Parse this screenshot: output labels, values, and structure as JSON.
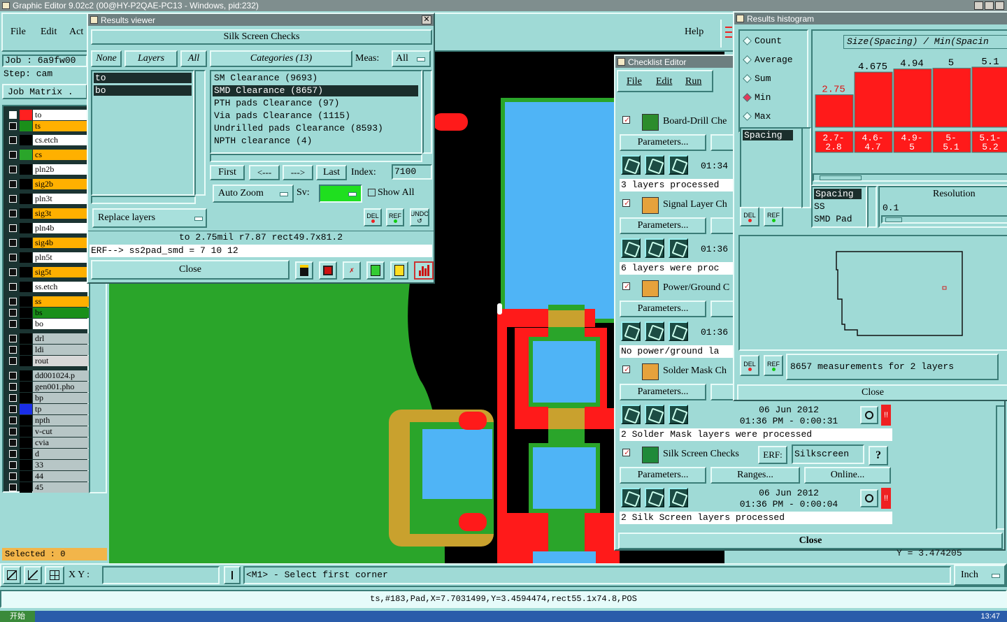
{
  "app": {
    "title": "Graphic Editor 9.02c2 (00@HY-P2QAE-PC13 - Windows, pid:232)"
  },
  "menu": {
    "file": "File",
    "edit": "Edit",
    "actions": "Act",
    "help": "Help"
  },
  "job": {
    "job_line": "Job :  6a9fw00",
    "step_line": "Step:  cam",
    "matrix_btn": "Job Matrix ."
  },
  "layers": [
    {
      "name": "to",
      "color": "#ff2020",
      "bg": "#ffffff"
    },
    {
      "name": "ts",
      "color": "#1a8f1a",
      "bg": "#ffb000"
    },
    {
      "name": "cs.etch",
      "color": "#000000",
      "bg": "#ffffff"
    },
    {
      "name": "cs",
      "color": "#2aa52a",
      "bg": "#ffb000"
    },
    {
      "name": "pln2b",
      "color": "#000000",
      "bg": "#ffffff"
    },
    {
      "name": "sig2b",
      "color": "#000000",
      "bg": "#ffb000"
    },
    {
      "name": "pln3t",
      "color": "#000000",
      "bg": "#ffffff"
    },
    {
      "name": "sig3t",
      "color": "#000000",
      "bg": "#ffb000"
    },
    {
      "name": "pln4b",
      "color": "#000000",
      "bg": "#ffffff"
    },
    {
      "name": "sig4b",
      "color": "#000000",
      "bg": "#ffb000"
    },
    {
      "name": "pln5t",
      "color": "#000000",
      "bg": "#ffffff"
    },
    {
      "name": "sig5t",
      "color": "#000000",
      "bg": "#ffb000"
    },
    {
      "name": "ss.etch",
      "color": "#000000",
      "bg": "#ffffff"
    },
    {
      "name": "ss",
      "color": "#000000",
      "bg": "#ffb000"
    },
    {
      "name": "bs",
      "color": "#000000",
      "bg": "#1a8f1a"
    },
    {
      "name": "bo",
      "color": "#000000",
      "bg": "#ffffff"
    },
    {
      "name": "drl",
      "color": "#000000",
      "bg": "#b7c6c6"
    },
    {
      "name": "ldi",
      "color": "#000000",
      "bg": "#b7c6c6"
    },
    {
      "name": "rout",
      "color": "#000000",
      "bg": "#d8d8d8"
    },
    {
      "name": "dd001024.p",
      "color": "#000000",
      "bg": "#b7c6c6"
    },
    {
      "name": "gen001.pho",
      "color": "#000000",
      "bg": "#b7c6c6"
    },
    {
      "name": "bp",
      "color": "#000000",
      "bg": "#b7c6c6"
    },
    {
      "name": "tp",
      "color": "#1a2ee8",
      "bg": "#b7c6c6"
    },
    {
      "name": "npth",
      "color": "#000000",
      "bg": "#b7c6c6"
    },
    {
      "name": "v-cut",
      "color": "#000000",
      "bg": "#b7c6c6"
    },
    {
      "name": "cvia",
      "color": "#000000",
      "bg": "#b7c6c6"
    },
    {
      "name": "d",
      "color": "#000000",
      "bg": "#b7c6c6"
    },
    {
      "name": "33",
      "color": "#000000",
      "bg": "#b7c6c6"
    },
    {
      "name": "44",
      "color": "#000000",
      "bg": "#b7c6c6"
    },
    {
      "name": "45",
      "color": "#000000",
      "bg": "#b7c6c6"
    }
  ],
  "selected": "Selected : 0",
  "results_viewer": {
    "title": "Results viewer",
    "header": "Silk Screen Checks",
    "none": "None",
    "layers": "Layers",
    "all": "All",
    "layer_items": [
      "to",
      "bo"
    ],
    "categories_btn": "Categories (13)",
    "meas_label": "Meas:",
    "meas_value": "All",
    "categories": [
      "SM Clearance (9693)",
      "SMD Clearance (8657)",
      "PTH pads Clearance (97)",
      "Via pads Clearance (1115)",
      "Undrilled pads Clearance (8593)",
      "NPTH clearance (4)"
    ],
    "first": "First",
    "prev": "<---",
    "next": "--->",
    "last": "Last",
    "index_label": "Index:",
    "index_value": "7100",
    "auto_zoom": "Auto Zoom",
    "sv": "Sv:",
    "show_all": "Show All",
    "replace_layers": "Replace layers",
    "del": "DEL",
    "ref": "REF",
    "undo": "UNDO",
    "meas_line": "to 2.75mil  r7.87  rect49.7x81.2",
    "erf_line": "ERF--> ss2pad_smd = 7 10 12",
    "close": "Close"
  },
  "checklist": {
    "title": "Checklist Editor",
    "menu": [
      "File",
      "Edit",
      "Run"
    ],
    "params": "Parameters...",
    "ranges": "Ranges...",
    "online": "Online...",
    "erf_label": "ERF:",
    "erf_value": "Silkscreen",
    "help": "?",
    "items": [
      {
        "name": "Board-Drill Che",
        "status": "3 layers processed",
        "time": "01:34",
        "date": ""
      },
      {
        "name": "Signal Layer Ch",
        "status": "6 layers were proc",
        "time": "01:36",
        "date": ""
      },
      {
        "name": "Power/Ground C",
        "status": "No power/ground la",
        "time": "01:36",
        "date": ""
      },
      {
        "name": "Solder Mask Ch",
        "status": "2 Solder Mask layers were processed",
        "time": "01:36 PM - 0:00:31",
        "date": "06 Jun 2012"
      },
      {
        "name": "Silk Screen Checks",
        "status": "2 Silk Screen layers processed",
        "time": "01:36 PM - 0:00:04",
        "date": "06 Jun 2012"
      }
    ],
    "close": "Close"
  },
  "histogram": {
    "title": "Results histogram",
    "modes": [
      "Count",
      "Average",
      "Sum",
      "Min",
      "Max"
    ],
    "selected_mode": "Min",
    "list_top": [
      "Spacing"
    ],
    "axis_title": "Size(Spacing) / Min(Spacin",
    "bar_values": [
      "2.75",
      "4.675",
      "4.94",
      "5",
      "5.1"
    ],
    "bins": [
      "2.7-\n2.8",
      "4.6-\n4.7",
      "4.9-\n5",
      "5-\n5.1",
      "5.1-\n5.2"
    ],
    "list_bottom": [
      "Spacing",
      "SS",
      "SMD Pad"
    ],
    "resolution_label": "Resolution",
    "resolution_value": "0.1",
    "del": "DEL",
    "ref": "REF",
    "measurements": "8657 measurements for 2 layers",
    "close": "Close"
  },
  "chart_data": {
    "type": "bar",
    "categories": [
      "2.7-2.8",
      "4.6-4.7",
      "4.9-5",
      "5-5.1",
      "5.1-5.2"
    ],
    "values": [
      2.75,
      4.675,
      4.94,
      5,
      5.1
    ],
    "title": "Size(Spacing) / Min(Spacin"
  },
  "bottom": {
    "xy_label": "X Y :",
    "xy_value": "",
    "hint": "<M1> - Select first corner",
    "unit": "Inch",
    "coord_behind": "Y = 3.474205",
    "status": "ts,#183,Pad,X=7.7031499,Y=3.4594474,rect55.1x74.8,POS"
  },
  "taskbar": {
    "start": "开始",
    "clock": "13:47"
  },
  "colors": {
    "teal": "#9fdad6",
    "canvas_bg": "#000000",
    "copper": "#2aa52a",
    "pad": "#4fb4f6",
    "silk": "#ff1a1a",
    "overlap": "#c9a12e"
  }
}
